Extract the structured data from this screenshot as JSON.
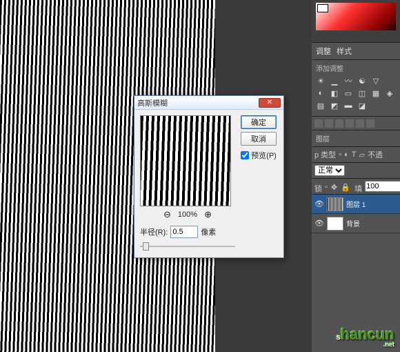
{
  "dialog": {
    "title": "高斯模糊",
    "ok": "确定",
    "cancel": "取消",
    "preview_label": "预览(P)",
    "zoom_percent": "100%",
    "radius_label": "半径(R):",
    "radius_value": "0.5",
    "radius_unit": "像素"
  },
  "panels": {
    "adjust_tab": "调整",
    "style_tab": "样式",
    "add_adjust": "添加调整",
    "layers_tab": "图层",
    "blend_label": "p 类型",
    "opacity_label": "不透",
    "opacity_value": "正常",
    "fill_label": "填充",
    "fill_value": "100",
    "lock_label": "锁定:"
  },
  "layers": [
    {
      "name": "图层 1",
      "selected": true,
      "thumb": "wave"
    },
    {
      "name": "背景",
      "selected": false,
      "thumb": "white"
    }
  ],
  "watermark": {
    "text": "shancun",
    "suffix": ".net"
  }
}
